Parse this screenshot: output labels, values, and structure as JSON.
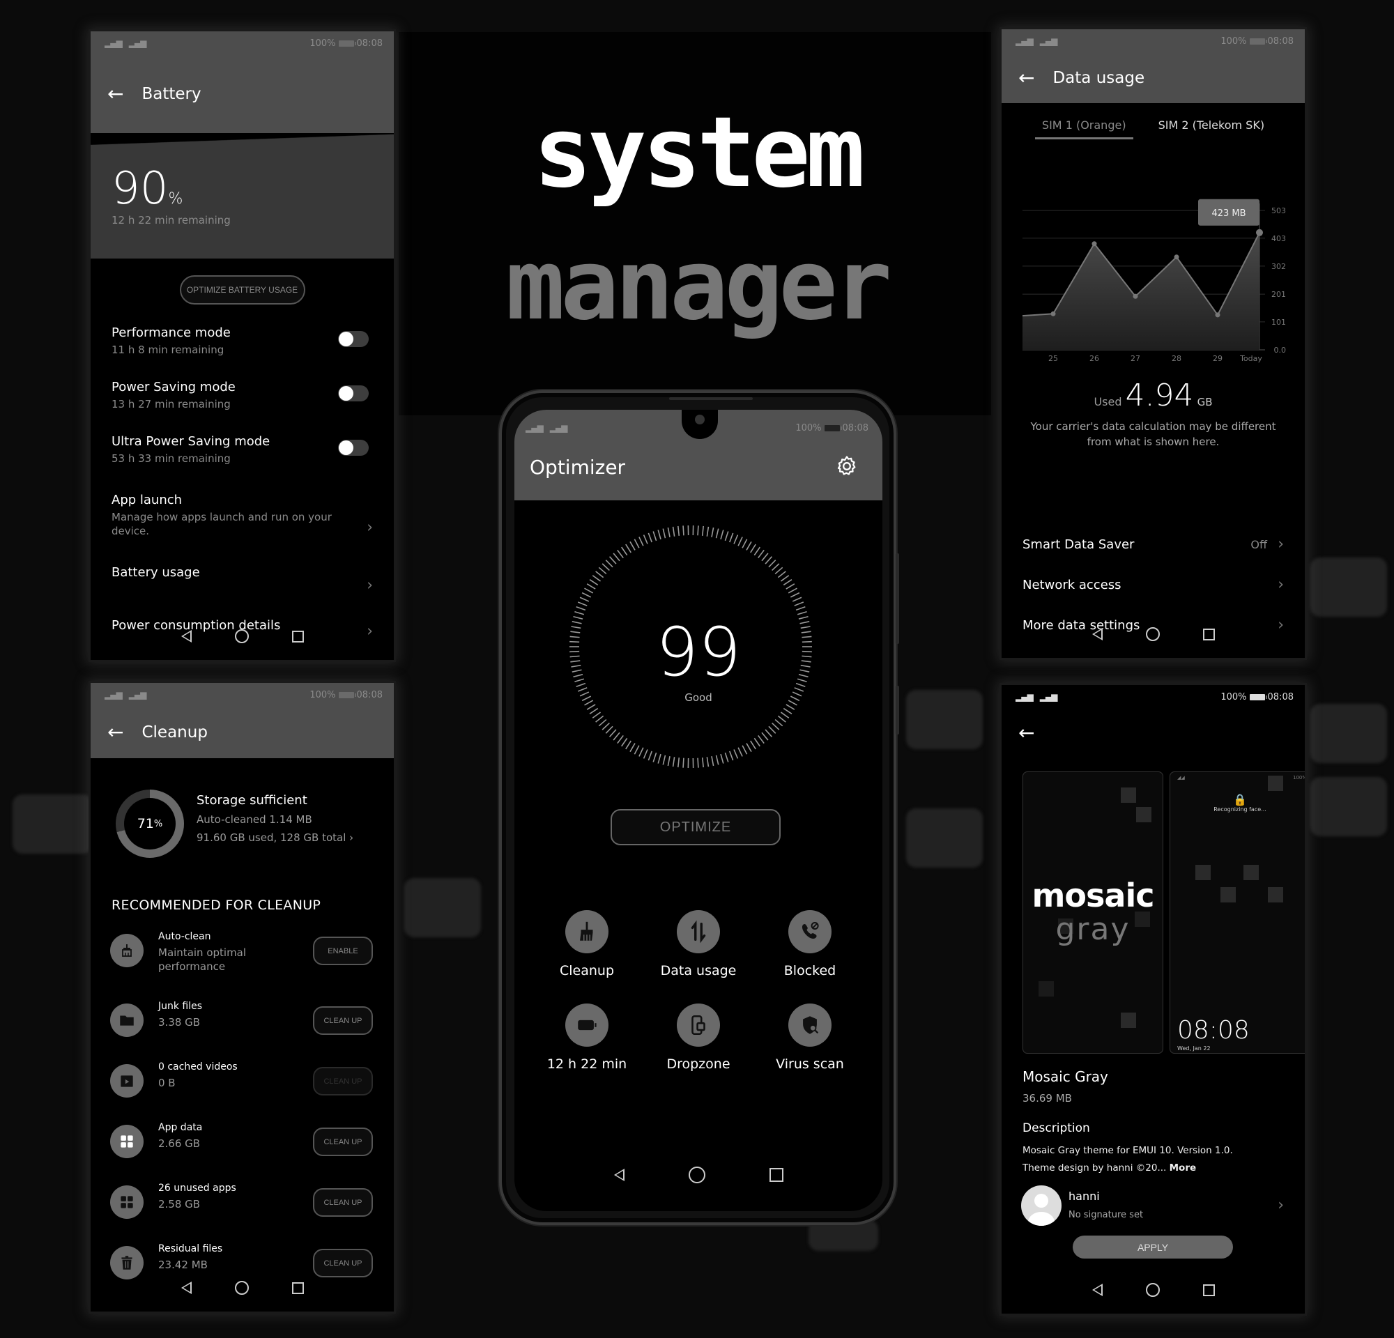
{
  "branding": {
    "line1": "system",
    "line2": "manager"
  },
  "status_bar": {
    "battery_pct": "100%",
    "time": "08:08",
    "signal": "▂▄▆"
  },
  "nav": {
    "back": "back",
    "home": "home",
    "recent": "recent"
  },
  "battery_panel": {
    "title": "Battery",
    "percent_value": "90",
    "percent_unit": "%",
    "remaining": "12 h 22 min remaining",
    "optimize_label": "OPTIMIZE BATTERY USAGE",
    "modes": [
      {
        "label": "Performance mode",
        "sub": "11 h 8 min remaining",
        "enabled": false
      },
      {
        "label": "Power Saving mode",
        "sub": "13 h 27 min remaining",
        "enabled": false
      },
      {
        "label": "Ultra Power Saving mode",
        "sub": "53 h 33 min remaining",
        "enabled": false
      }
    ],
    "links": [
      {
        "label": "App launch",
        "sub": "Manage how apps launch and run on your device."
      },
      {
        "label": "Battery usage"
      },
      {
        "label": "Power consumption details"
      }
    ]
  },
  "cleanup_panel": {
    "title": "Cleanup",
    "storage_percent_value": "71",
    "storage_percent_unit": "%",
    "storage_used_fraction": 0.71,
    "storage_status": "Storage sufficient",
    "auto_cleaned": "Auto-cleaned 1.14 MB",
    "usage": "91.60 GB used, 128 GB total",
    "section_title": "RECOMMENDED FOR CLEANUP",
    "items": [
      {
        "icon": "brush-icon",
        "name": "Auto-clean",
        "value": "Maintain optimal performance",
        "button": "ENABLE",
        "disabled": false
      },
      {
        "icon": "folder-icon",
        "name": "Junk files",
        "value": "3.38 GB",
        "button": "CLEAN UP",
        "disabled": false
      },
      {
        "icon": "video-icon",
        "name": "0 cached videos",
        "value": "0 B",
        "button": "CLEAN UP",
        "disabled": true
      },
      {
        "icon": "app-data-icon",
        "name": "App data",
        "value": "2.66 GB",
        "button": "CLEAN UP",
        "disabled": false
      },
      {
        "icon": "apps-icon",
        "name": "26 unused apps",
        "value": "2.58 GB",
        "button": "CLEAN UP",
        "disabled": false
      },
      {
        "icon": "trash-icon",
        "name": "Residual files",
        "value": "23.42 MB",
        "button": "CLEAN UP",
        "disabled": false
      }
    ]
  },
  "optimizer_panel": {
    "title": "Optimizer",
    "score": "99",
    "score_label": "Good",
    "optimize_label": "OPTIMIZE",
    "tools": [
      {
        "icon": "broom-icon",
        "label": "Cleanup"
      },
      {
        "icon": "data-transfer-icon",
        "label": "Data usage"
      },
      {
        "icon": "blocked-call-icon",
        "label": "Blocked"
      },
      {
        "icon": "battery-icon",
        "label": "12 h 22 min"
      },
      {
        "icon": "dropzone-icon",
        "label": "Dropzone"
      },
      {
        "icon": "virus-scan-icon",
        "label": "Virus scan"
      }
    ]
  },
  "data_usage_panel": {
    "title": "Data usage",
    "sim_tabs": [
      {
        "label": "SIM 1 (Orange)",
        "active": true
      },
      {
        "label": "SIM 2 (Telekom SK)",
        "active": false
      }
    ],
    "used_label": "Used",
    "used_value": "4.94",
    "used_unit": "GB",
    "carrier_note": "Your carrier's data calculation may be different from what is shown here.",
    "settings": [
      {
        "label": "Smart Data Saver",
        "value": "Off"
      },
      {
        "label": "Network access",
        "value": ""
      },
      {
        "label": "More data settings",
        "value": ""
      }
    ]
  },
  "chart_data": {
    "type": "area",
    "title": "",
    "xlabel": "",
    "ylabel": "MB",
    "categories": [
      "",
      "25",
      "26",
      "27",
      "28",
      "29",
      "Today"
    ],
    "values": [
      123,
      130,
      383,
      193,
      335,
      126,
      423
    ],
    "y_ticks": [
      "0.0",
      "101",
      "201",
      "302",
      "403",
      "503"
    ],
    "ylim": [
      0,
      503
    ],
    "grid": true,
    "tooltip": {
      "index": 6,
      "label": "423 MB"
    },
    "y_axis_position": "right"
  },
  "theme_panel": {
    "preview_logo_line1": "mosaic",
    "preview_logo_line2": "gray",
    "lock_text": "Recognizing face...",
    "lock_clock": "08:08",
    "lock_date": "Wed, Jan 22",
    "name": "Mosaic Gray",
    "size": "36.69 MB",
    "description_title": "Description",
    "description_line1": "Mosaic Gray theme for EMUI 10. Version 1.0.",
    "description_line2": "Theme design by hanni ©20...",
    "more_label": "More",
    "author_name": "hanni",
    "author_signature": "No signature set",
    "apply_label": "APPLY"
  }
}
